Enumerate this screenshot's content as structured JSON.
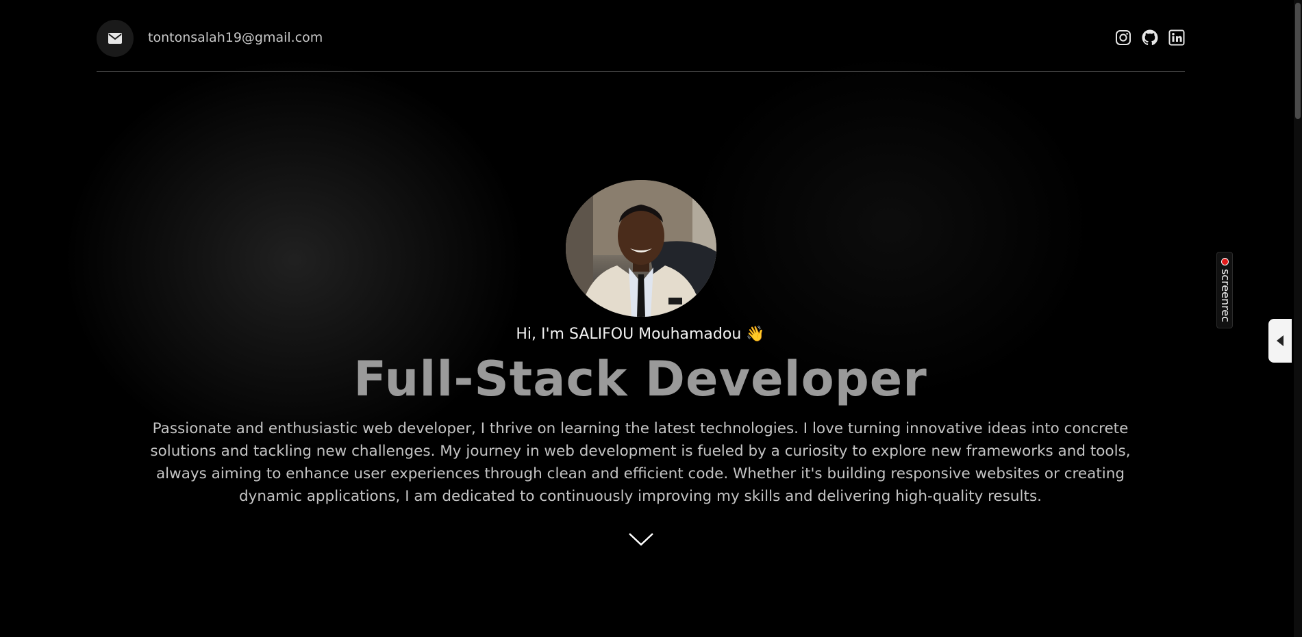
{
  "header": {
    "email": "tontonsalah19@gmail.com",
    "email_icon": "envelope-icon",
    "social_icons": [
      "instagram-icon",
      "github-icon",
      "linkedin-icon"
    ]
  },
  "hero": {
    "greeting": "Hi, I'm SALIFOU Mouhamadou 👋",
    "title": "Full-Stack Developer",
    "description": "Passionate and enthusiastic web developer, I thrive on learning the latest technologies. I love turning innovative ideas into concrete solutions and tackling new challenges. My journey in web development is fueled by a curiosity to explore new frameworks and tools, always aiming to enhance user experiences through clean and efficient code. Whether it's building responsive websites or creating dynamic applications, I am dedicated to continuously improving my skills and delivering high-quality results.",
    "scroll_icon": "chevron-down-icon"
  },
  "overlay": {
    "recorder_label": "screenrec",
    "side_tab_icon": "caret-left-icon"
  },
  "colors": {
    "background": "#000000",
    "title": "#9a9a9a",
    "text": "#c4c4c4",
    "recorder_dot": "#e21a1a"
  }
}
